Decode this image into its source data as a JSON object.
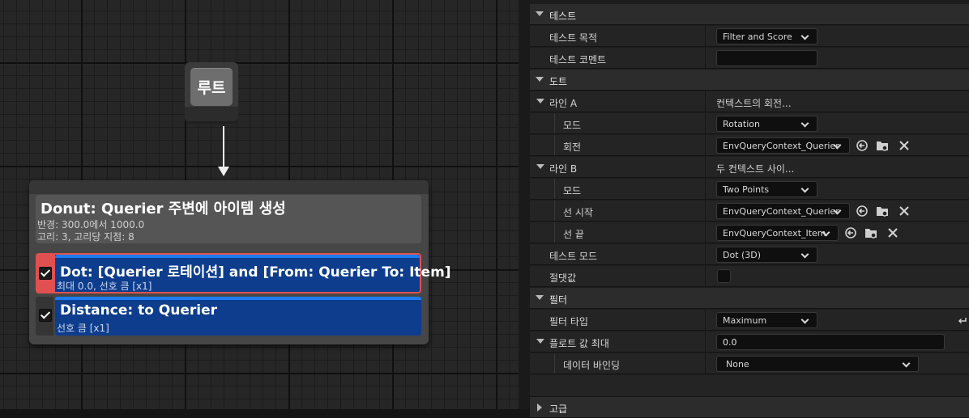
{
  "graph": {
    "root": {
      "title": "루트"
    },
    "composite": {
      "title": "Donut: Querier 주변에 아이템 생성",
      "line1": "반경: 300.0에서 1000.0",
      "line2": "고리: 3, 고리당 지점: 8"
    },
    "tests": [
      {
        "title": "Dot: [Querier 로테이션] and [From: Querier To: Item]",
        "subtitle": "최대 0.0, 선호 큼 [x1]",
        "checked": true,
        "selected": true
      },
      {
        "title": "Distance: to Querier",
        "subtitle": "선호 큼 [x1]",
        "checked": true,
        "selected": false
      }
    ]
  },
  "details": {
    "cat_test": "테스트",
    "test_purpose_label": "테스트 목적",
    "test_purpose_value": "Filter and Score",
    "test_comment_label": "테스트 코멘트",
    "test_comment_value": "",
    "cat_dot": "도트",
    "lineA_label": "라인 A",
    "lineA_summary": "컨텍스트의 회전...",
    "lineA_mode_label": "모드",
    "lineA_mode_value": "Rotation",
    "lineA_rot_label": "회전",
    "lineA_rot_value": "EnvQueryContext_Querier",
    "lineB_label": "라인 B",
    "lineB_summary": "두 컨텍스트 사이...",
    "lineB_mode_label": "모드",
    "lineB_mode_value": "Two Points",
    "lineB_start_label": "선 시작",
    "lineB_start_value": "EnvQueryContext_Querier",
    "lineB_end_label": "선 끝",
    "lineB_end_value": "EnvQueryContext_Item",
    "test_mode_label": "테스트 모드",
    "test_mode_value": "Dot (3D)",
    "absolute_label": "절댓값",
    "cat_filter": "필터",
    "filter_type_label": "필터 타입",
    "filter_type_value": "Maximum",
    "float_max_label": "플로트 값 최대",
    "float_max_value": "0.0",
    "data_binding_label": "데이터 바인딩",
    "data_binding_value": "None",
    "cat_advanced": "고급"
  },
  "colors": {
    "test_blue": "#0d3d8c",
    "test_stripe": "#1d7cf2",
    "selection_red": "#e05050"
  }
}
